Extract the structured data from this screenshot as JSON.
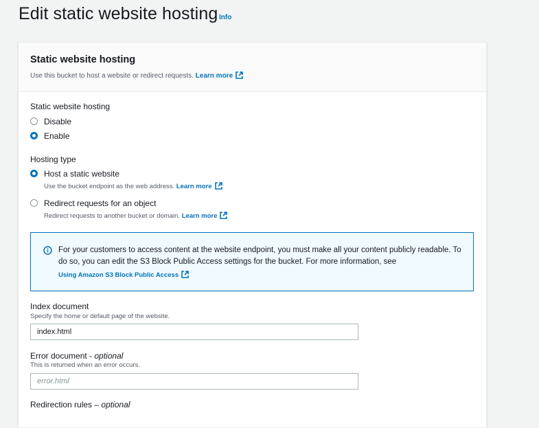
{
  "page": {
    "title": "Edit static website hosting",
    "info_link": "Info"
  },
  "card": {
    "title": "Static website hosting",
    "description": "Use this bucket to host a website or redirect requests.",
    "learn_more": "Learn more"
  },
  "hosting_toggle": {
    "label": "Static website hosting",
    "options": [
      {
        "label": "Disable",
        "checked": false
      },
      {
        "label": "Enable",
        "checked": true
      }
    ]
  },
  "hosting_type": {
    "label": "Hosting type",
    "options": [
      {
        "label": "Host a static website",
        "description": "Use the bucket endpoint as the web address.",
        "learn_more": "Learn more",
        "checked": true
      },
      {
        "label": "Redirect requests for an object",
        "description": "Redirect requests to another bucket or domain.",
        "learn_more": "Learn more",
        "checked": false
      }
    ]
  },
  "alert": {
    "text": "For your customers to access content at the website endpoint, you must make all your content publicly readable. To do so, you can edit the S3 Block Public Access settings for the bucket. For more information, see",
    "link": "Using Amazon S3 Block Public Access"
  },
  "index_document": {
    "label": "Index document",
    "description": "Specify the home or default page of the website.",
    "value": "index.html"
  },
  "error_document": {
    "label": "Error document",
    "optional": "optional",
    "description": "This is returned when an error occurs.",
    "placeholder": "error.html"
  },
  "redirection_rules": {
    "label": "Redirection rules",
    "optional": "optional"
  },
  "colors": {
    "link": "#0073bb",
    "alert_bg": "#f1faff",
    "alert_border": "#0073bb"
  }
}
